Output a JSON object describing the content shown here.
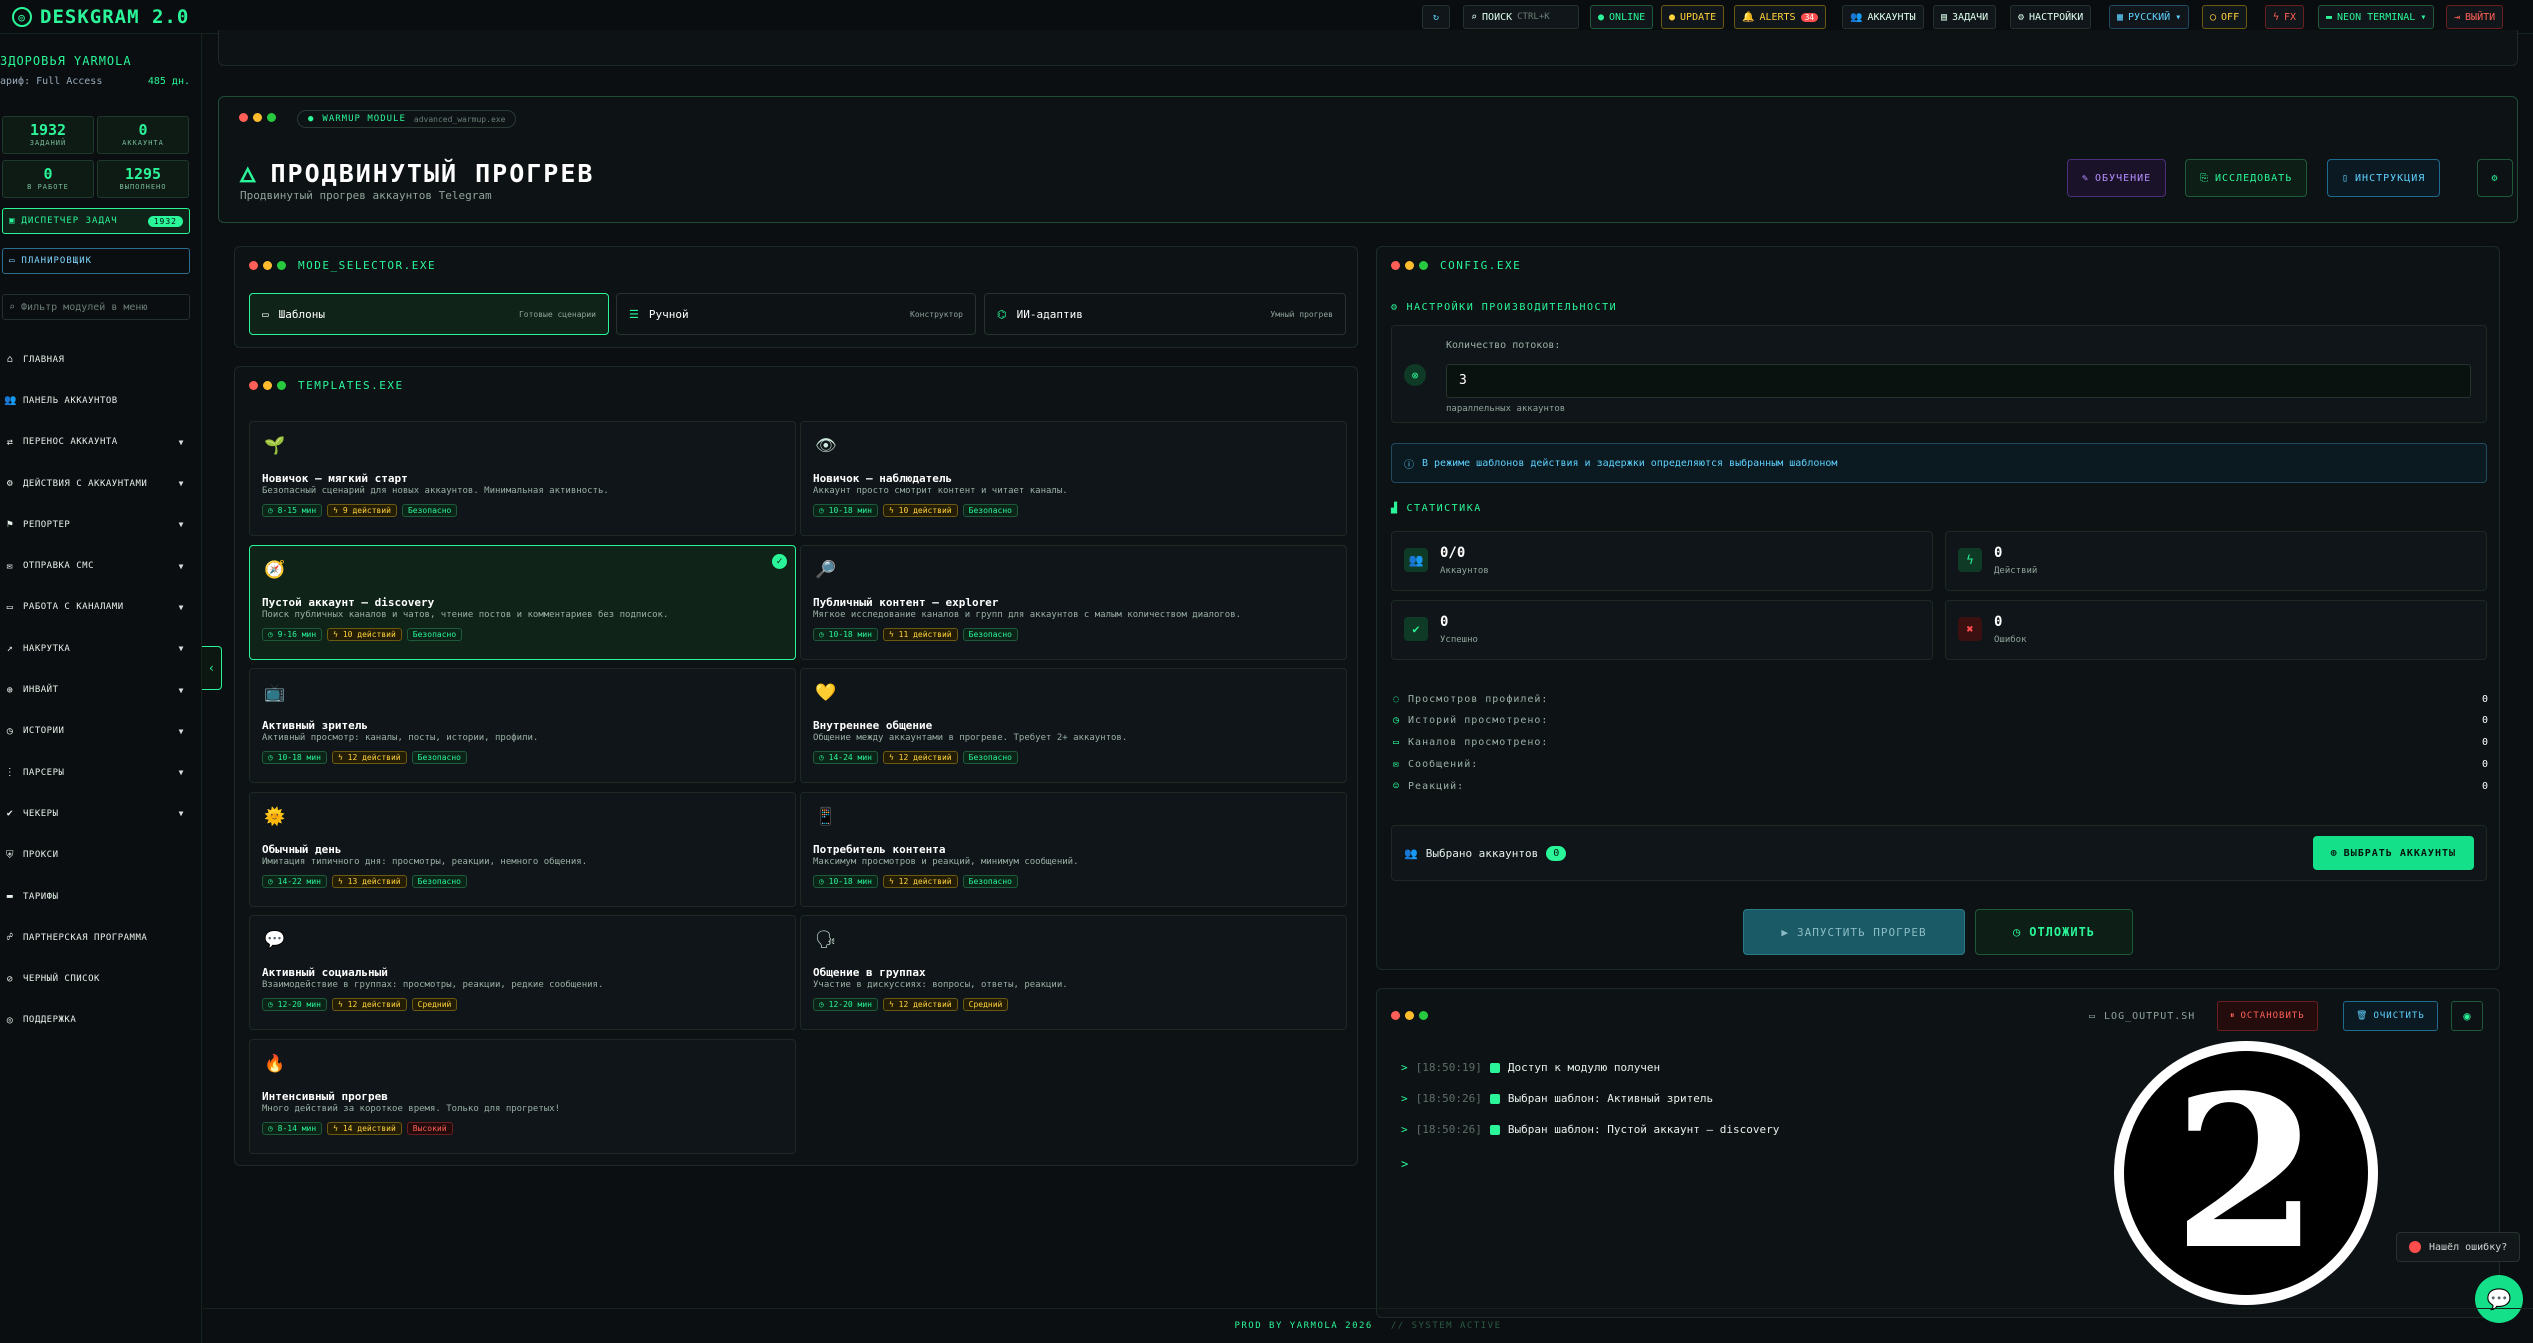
{
  "app": {
    "title": "DESKGRAM 2.0"
  },
  "topbar": {
    "search_label": "ПОИСК",
    "search_kbd": "CTRL+K",
    "online": "ONLINE",
    "update": "UPDATE",
    "alerts": "ALERTS",
    "alerts_count": "34",
    "accounts": "АККАУНТЫ",
    "tasks": "ЗАДАЧИ",
    "settings": "НАСТРОЙКИ",
    "language": "РУССКИЙ",
    "off": "OFF",
    "fx": "FX",
    "theme": "NEON TERMINAL",
    "logout": "ВЫЙТИ"
  },
  "sidebar": {
    "user_name": "ЗДОРОВЬЯ YARMOLA",
    "tariff_label": "ариф: Full Access",
    "tariff_days": "485 дн.",
    "stats": [
      {
        "value": "1932",
        "label": "ЗАДАНИЙ"
      },
      {
        "value": "0",
        "label": "АККАУНТА"
      },
      {
        "value": "0",
        "label": "В РАБОТЕ"
      },
      {
        "value": "1295",
        "label": "ВЫПОЛНЕНО"
      }
    ],
    "dispatcher": "ДИСПЕТЧЕР ЗАДАЧ",
    "dispatcher_badge": "1932",
    "scheduler": "ПЛАНИРОВЩИК",
    "filter_placeholder": "Фильтр модулей в меню",
    "items": [
      {
        "label": "ГЛАВНАЯ",
        "icon": "home-icon",
        "chev": false
      },
      {
        "label": "ПАНЕЛЬ АККАУНТОВ",
        "icon": "users-icon",
        "chev": false
      },
      {
        "label": "ПЕРЕНОС АККАУНТА",
        "icon": "transfer-icon",
        "chev": true
      },
      {
        "label": "ДЕЙСТВИЯ С АККАУНТАМИ",
        "icon": "user-cog-icon",
        "chev": true
      },
      {
        "label": "РЕПОРТЕР",
        "icon": "flag-icon",
        "chev": true
      },
      {
        "label": "ОТПРАВКА СМС",
        "icon": "message-icon",
        "chev": true
      },
      {
        "label": "РАБОТА С КАНАЛАМИ",
        "icon": "channel-icon",
        "chev": true
      },
      {
        "label": "НАКРУТКА",
        "icon": "chart-icon",
        "chev": true
      },
      {
        "label": "ИНВАЙТ",
        "icon": "user-plus-icon",
        "chev": true
      },
      {
        "label": "ИСТОРИИ",
        "icon": "history-icon",
        "chev": true
      },
      {
        "label": "ПАРСЕРЫ",
        "icon": "parser-icon",
        "chev": true
      },
      {
        "label": "ЧЕКЕРЫ",
        "icon": "check-icon",
        "chev": true
      },
      {
        "label": "ПРОКСИ",
        "icon": "shield-icon",
        "chev": false
      },
      {
        "label": "ТАРИФЫ",
        "icon": "card-icon",
        "chev": false
      },
      {
        "label": "ПАРТНЕРСКАЯ ПРОГРАММА",
        "icon": "partners-icon",
        "chev": false
      },
      {
        "label": "ЧЕРНЫЙ СПИСОК",
        "icon": "blacklist-icon",
        "chev": false
      },
      {
        "label": "ПОДДЕРЖКА",
        "icon": "support-icon",
        "chev": false
      }
    ]
  },
  "hero": {
    "chip": "WARMUP MODULE",
    "chip_id": "advanced_warmup.exe",
    "title": "ПРОДВИНУТЫЙ ПРОГРЕВ",
    "subtitle": "Продвинутый прогрев аккаунтов Telegram",
    "btn_learn": "ОБУЧЕНИЕ",
    "btn_explore": "ИССЛЕДОВАТЬ",
    "btn_guide": "ИНСТРУКЦИЯ"
  },
  "mode": {
    "title": "MODE_SELECTOR.EXE",
    "cards": [
      {
        "label": "Шаблоны",
        "hint": "Готовые сценарии"
      },
      {
        "label": "Ручной",
        "hint": "Конструктор"
      },
      {
        "label": "ИИ-адаптив",
        "hint": "Умный прогрев"
      }
    ]
  },
  "templates": {
    "title": "TEMPLATES.EXE",
    "items": [
      {
        "emoji": "🌱",
        "title": "Новичок — мягкий старт",
        "desc": "Безопасный сценарий для новых аккаунтов. Минимальная активность.",
        "time": "8-15 мин",
        "acts": "9 действий",
        "risk": "Безопасно",
        "lvl": "s"
      },
      {
        "emoji": "👁",
        "title": "Новичок — наблюдатель",
        "desc": "Аккаунт просто смотрит контент и читает каналы.",
        "time": "10-18 мин",
        "acts": "10 действий",
        "risk": "Безопасно",
        "lvl": "s"
      },
      {
        "emoji": "🧭",
        "title": "Пустой аккаунт — discovery",
        "desc": "Поиск публичных каналов и чатов, чтение постов и комментариев без подписок.",
        "time": "9-16 мин",
        "acts": "10 действий",
        "risk": "Безопасно",
        "lvl": "s"
      },
      {
        "emoji": "🔎",
        "title": "Публичный контент — explorer",
        "desc": "Мягкое исследование каналов и групп для аккаунтов с малым количеством диалогов.",
        "time": "10-18 мин",
        "acts": "11 действий",
        "risk": "Безопасно",
        "lvl": "s"
      },
      {
        "emoji": "📺",
        "title": "Активный зритель",
        "desc": "Активный просмотр: каналы, посты, истории, профили.",
        "time": "10-18 мин",
        "acts": "12 действий",
        "risk": "Безопасно",
        "lvl": "s"
      },
      {
        "emoji": "💛",
        "title": "Внутреннее общение",
        "desc": "Общение между аккаунтами в прогреве. Требует 2+ аккаунтов.",
        "time": "14-24 мин",
        "acts": "12 действий",
        "risk": "Безопасно",
        "lvl": "s"
      },
      {
        "emoji": "🌞",
        "title": "Обычный день",
        "desc": "Имитация типичного дня: просмотры, реакции, немного общения.",
        "time": "14-22 мин",
        "acts": "13 действий",
        "risk": "Безопасно",
        "lvl": "s"
      },
      {
        "emoji": "📱",
        "title": "Потребитель контента",
        "desc": "Максимум просмотров и реакций, минимум сообщений.",
        "time": "10-18 мин",
        "acts": "12 действий",
        "risk": "Безопасно",
        "lvl": "s"
      },
      {
        "emoji": "💬",
        "title": "Активный социальный",
        "desc": "Взаимодействие в группах: просмотры, реакции, редкие сообщения.",
        "time": "12-20 мин",
        "acts": "12 действий",
        "risk": "Средний",
        "lvl": "m"
      },
      {
        "emoji": "🗣",
        "title": "Общение в группах",
        "desc": "Участие в дискуссиях: вопросы, ответы, реакции.",
        "time": "12-20 мин",
        "acts": "12 действий",
        "risk": "Средний",
        "lvl": "m"
      },
      {
        "emoji": "🔥",
        "title": "Интенсивный прогрев",
        "desc": "Много действий за короткое время. Только для прогретых!",
        "time": "8-14 мин",
        "acts": "14 действий",
        "risk": "Высокий",
        "lvl": "h"
      }
    ]
  },
  "config": {
    "title": "CONFIG.EXE",
    "perf_title": "НАСТРОЙКИ ПРОИЗВОДИТЕЛЬНОСТИ",
    "threads_label": "Количество потоков:",
    "threads_value": "3",
    "threads_hint": "параллельных аккаунтов",
    "info": "В режиме шаблонов действия и задержки определяются выбранным шаблоном",
    "stats_title": "СТАТИСТИКА",
    "stats": [
      {
        "value": "0/0",
        "label": "Аккаунтов",
        "color": "#2af598"
      },
      {
        "value": "0",
        "label": "Действий",
        "color": "#2af598"
      },
      {
        "value": "0",
        "label": "Успешно",
        "color": "#2af598"
      },
      {
        "value": "0",
        "label": "Ошибок",
        "color": "#ff4d4d"
      }
    ],
    "metrics": [
      {
        "label": "Просмотров профилей:",
        "value": "0"
      },
      {
        "label": "Историй просмотрено:",
        "value": "0"
      },
      {
        "label": "Каналов просмотрено:",
        "value": "0"
      },
      {
        "label": "Сообщений:",
        "value": "0"
      },
      {
        "label": "Реакций:",
        "value": "0"
      }
    ],
    "selected_label": "Выбрано аккаунтов",
    "selected_count": "0",
    "select_btn": "ВЫБРАТЬ АККАУНТЫ",
    "start_btn": "ЗАПУСТИТЬ ПРОГРЕВ",
    "delay_btn": "ОТЛОЖИТЬ"
  },
  "log": {
    "title": "LOG_OUTPUT.SH",
    "stop": "ОСТАНОВИТЬ",
    "clear": "ОЧИСТИТЬ",
    "rows": [
      {
        "ts": "[18:50:19]",
        "text": "Доступ к модулю получен"
      },
      {
        "ts": "[18:50:26]",
        "text": "Выбран шаблон: Активный зритель"
      },
      {
        "ts": "[18:50:26]",
        "text": "Выбран шаблон: Пустой аккаунт — discovery"
      }
    ],
    "prompt": ">"
  },
  "overlay": {
    "badge_number": "2",
    "bug_label": "Нашёл ошибку?"
  },
  "footer": {
    "credit": "PROD BY YARMOLA 2026",
    "status": "// SYSTEM ACTIVE"
  }
}
